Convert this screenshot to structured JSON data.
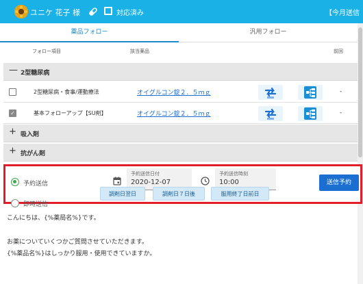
{
  "header": {
    "user_name": "ユニケ 花子 様",
    "status_label": "対応済み",
    "monthly_label": "【今月送信",
    "bg_color": "#1ab1e6",
    "icons": [
      "sunflower-avatar",
      "pill-icon",
      "checkbox-icon"
    ]
  },
  "tabs": [
    {
      "label": "薬品フォロー",
      "active": true
    },
    {
      "label": "汎用フォロー",
      "active": false
    }
  ],
  "columns": {
    "follow_item": "フォロー項目",
    "drug": "該当薬品",
    "previous": "前回"
  },
  "groups": [
    {
      "sign": "—",
      "name": "2型糖尿病",
      "expanded": true,
      "rows": [
        {
          "checked": false,
          "item": "2型糖尿病・食事/運動療法",
          "drug": "オイグルコン錠２．５ｍｇ",
          "previous": "-"
        },
        {
          "checked": true,
          "item": "基本フォローアップ【SU剤】",
          "drug": "オイグルコン錠２．５ｍｇ",
          "previous": "-"
        }
      ]
    },
    {
      "sign": "+",
      "name": "吸入剤",
      "expanded": false
    },
    {
      "sign": "+",
      "name": "抗がん剤",
      "expanded": false
    }
  ],
  "schedule": {
    "option_reserved": "予約送信",
    "option_immediate": "即時送信",
    "selected": "予約送信",
    "date_label": "予約送信日付",
    "date_value": "2020-12-07",
    "time_label": "予約送信時刻",
    "time_value": "10:00",
    "reserve_button": "送信予約",
    "quick_buttons": [
      "調剤日翌日",
      "調剤日７日後",
      "服用終了日前日"
    ],
    "highlight_color": "#e11d2a",
    "accent_color": "#1a6fd1"
  },
  "message": {
    "lines": [
      "こんにちは、{%薬局名%}です。",
      "",
      "お薬についていくつかご質問させていただきます。",
      "{%薬品名%}はしっかり服用・使用できていますか。"
    ]
  }
}
